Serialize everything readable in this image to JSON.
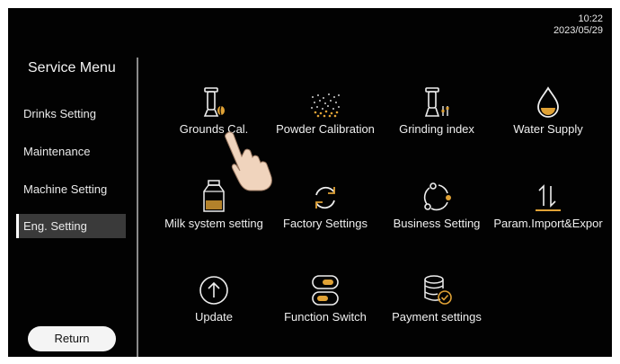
{
  "clock": {
    "time": "10:22",
    "date": "2023/05/29"
  },
  "sidebar": {
    "title": "Service Menu",
    "items": [
      {
        "label": "Drinks Setting"
      },
      {
        "label": "Maintenance"
      },
      {
        "label": "Machine Setting"
      },
      {
        "label": "Eng. Setting",
        "active": true
      }
    ],
    "return_label": "Return"
  },
  "grid": {
    "tiles": [
      {
        "label": "Grounds Cal.",
        "icon": "grounds-canister-icon"
      },
      {
        "label": "Powder Calibration",
        "icon": "powder-icon"
      },
      {
        "label": "Grinding index",
        "icon": "grinder-icon"
      },
      {
        "label": "Water Supply",
        "icon": "water-drop-icon"
      },
      {
        "label": "Milk system setting",
        "icon": "milk-carton-icon"
      },
      {
        "label": "Factory Settings",
        "icon": "reset-cycle-icon"
      },
      {
        "label": "Business Setting",
        "icon": "network-cycle-icon"
      },
      {
        "label": "Param.Import&Expor",
        "icon": "import-export-icon"
      },
      {
        "label": "Update",
        "icon": "upload-circle-icon"
      },
      {
        "label": "Function Switch",
        "icon": "toggle-switch-icon"
      },
      {
        "label": "Payment settings",
        "icon": "database-check-icon"
      }
    ]
  },
  "colors": {
    "background": "#020202",
    "accent": "#e0a236",
    "text": "#efefef",
    "active_item": "#3a3a3a"
  }
}
